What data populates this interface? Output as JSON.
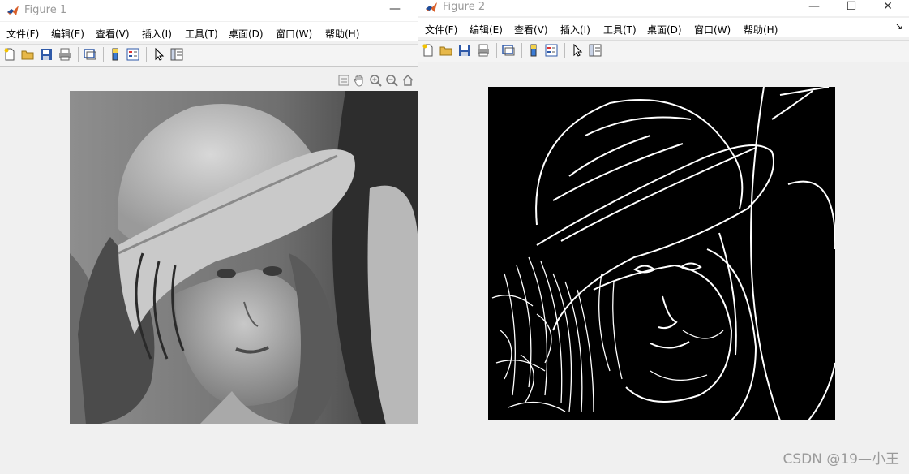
{
  "figure1": {
    "title": "Figure 1",
    "menus": [
      "文件(F)",
      "编辑(E)",
      "查看(V)",
      "插入(I)",
      "工具(T)",
      "桌面(D)",
      "窗口(W)",
      "帮助(H)"
    ],
    "window_controls": {
      "minimize": "—"
    }
  },
  "figure2": {
    "title": "Figure 2",
    "menus": [
      "文件(F)",
      "编辑(E)",
      "查看(V)",
      "插入(I)",
      "工具(T)",
      "桌面(D)",
      "窗口(W)",
      "帮助(H)"
    ],
    "window_controls": {
      "minimize": "—",
      "maximize": "☐",
      "close": "✕"
    },
    "dock_arrow": "↘"
  },
  "watermark": "CSDN @19—小王",
  "colors": {
    "titlebar": "#ffffff",
    "window_bg": "#f0f0f0",
    "matlab_orange": "#d9602b",
    "matlab_blue": "#1f4e9c"
  },
  "icons": {
    "toolbar": [
      "new-figure-icon",
      "open-file-icon",
      "save-icon",
      "print-icon",
      "link-plot-icon",
      "colorbar-icon",
      "legend-icon",
      "edit-plot-arrow-icon",
      "property-inspector-icon"
    ],
    "axes_toolbar": [
      "data-tips-icon",
      "pan-hand-icon",
      "zoom-in-icon",
      "zoom-out-icon",
      "home-restore-icon"
    ]
  }
}
